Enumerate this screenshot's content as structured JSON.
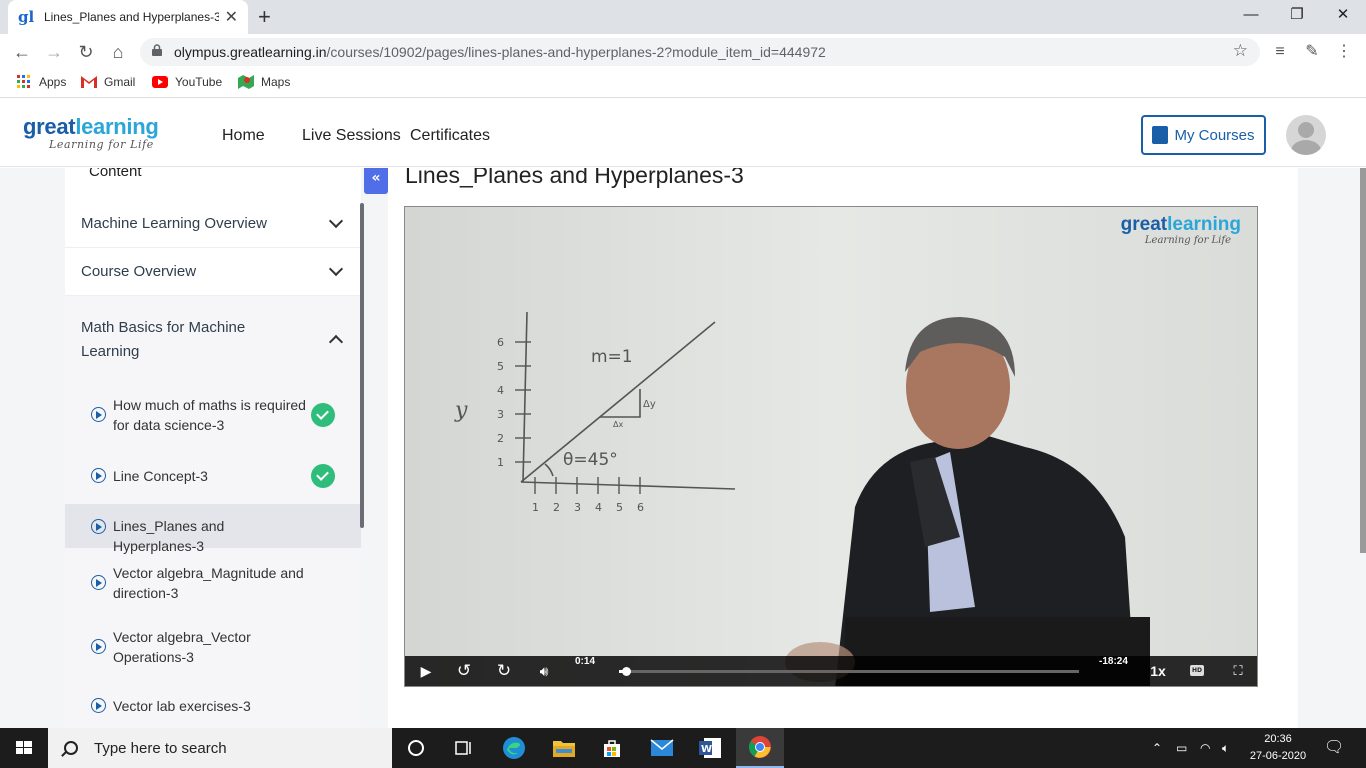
{
  "browser": {
    "tab_title": "Lines_Planes and Hyperplanes-3",
    "url_domain": "olympus.greatlearning.in",
    "url_path": "/courses/10902/pages/lines-planes-and-hyperplanes-2?module_item_id=444972",
    "bookmarks": [
      {
        "label": "Apps",
        "icon": "apps-grid-icon"
      },
      {
        "label": "Gmail",
        "icon": "gmail-icon"
      },
      {
        "label": "YouTube",
        "icon": "youtube-icon"
      },
      {
        "label": "Maps",
        "icon": "maps-icon"
      }
    ]
  },
  "site": {
    "logo_main": "great",
    "logo_accent": "learning",
    "logo_tagline": "Learning for Life",
    "nav": [
      "Home",
      "Live Sessions",
      "Certificates"
    ],
    "my_courses_label": "My Courses"
  },
  "sidebar": {
    "header": "Content",
    "collapse_label": "«",
    "modules": [
      {
        "title": "Machine Learning Overview",
        "expanded": false
      },
      {
        "title": "Course Overview",
        "expanded": false
      },
      {
        "title": "Math Basics for Machine Learning",
        "expanded": true
      }
    ],
    "items": [
      {
        "title": "How much of maths is required for data science-3",
        "completed": true
      },
      {
        "title": "Line Concept-3",
        "completed": true
      },
      {
        "title": "Lines_Planes and Hyperplanes-3",
        "completed": false,
        "active": true
      },
      {
        "title": "Vector algebra_Magnitude and direction-3",
        "completed": false
      },
      {
        "title": "Vector algebra_Vector Operations-3",
        "completed": false
      },
      {
        "title": "Vector lab exercises-3",
        "completed": false
      }
    ]
  },
  "lesson": {
    "title": "Lines_Planes and Hyperplanes-3",
    "player": {
      "elapsed": "0:14",
      "remaining": "-18:24",
      "speed": "1x",
      "hd_label": "HD",
      "progress_fraction": 0.016,
      "whiteboard": {
        "y_label": "y",
        "slope_text": "m=1",
        "angle_text": "θ=45°",
        "delta_y": "Δy",
        "delta_x": "Δx",
        "y_ticks": [
          "1",
          "2",
          "3",
          "4",
          "5",
          "6"
        ],
        "x_ticks": [
          "1",
          "2",
          "3",
          "4",
          "5",
          "6"
        ]
      }
    }
  },
  "taskbar": {
    "search_placeholder": "Type here to search",
    "time": "20:36",
    "date": "27-06-2020"
  },
  "colors": {
    "brand_blue": "#1a5ea8",
    "brand_light": "#2aa6d8",
    "check_green": "#2ebd7a",
    "collapse_blue": "#4f6ee8"
  }
}
